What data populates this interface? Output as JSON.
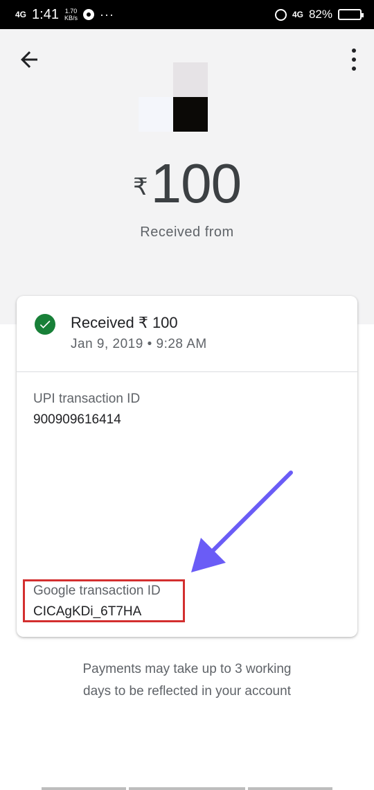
{
  "status_bar": {
    "network": "4G",
    "time": "1:41",
    "speed_value": "1.70",
    "speed_unit": "KB/s",
    "more": "···",
    "network_right": "4G",
    "battery": "82%",
    "battery_level": 0.82
  },
  "header": {
    "currency_symbol": "₹",
    "amount": "100",
    "subtitle": "Received from"
  },
  "card": {
    "status_title": "Received ₹ 100",
    "status_date": "Jan 9, 2019 • 9:28 AM",
    "upi_label": "UPI transaction ID",
    "upi_value": "900909616414",
    "google_label": "Google transaction ID",
    "google_value": "CICAgKDi_6T7HA"
  },
  "footer": {
    "line1": "Payments may take up to 3 working",
    "line2": "days to be reflected in your account"
  },
  "colors": {
    "success": "#188038",
    "highlight": "#d32f2f",
    "arrow": "#6a5cf6"
  }
}
